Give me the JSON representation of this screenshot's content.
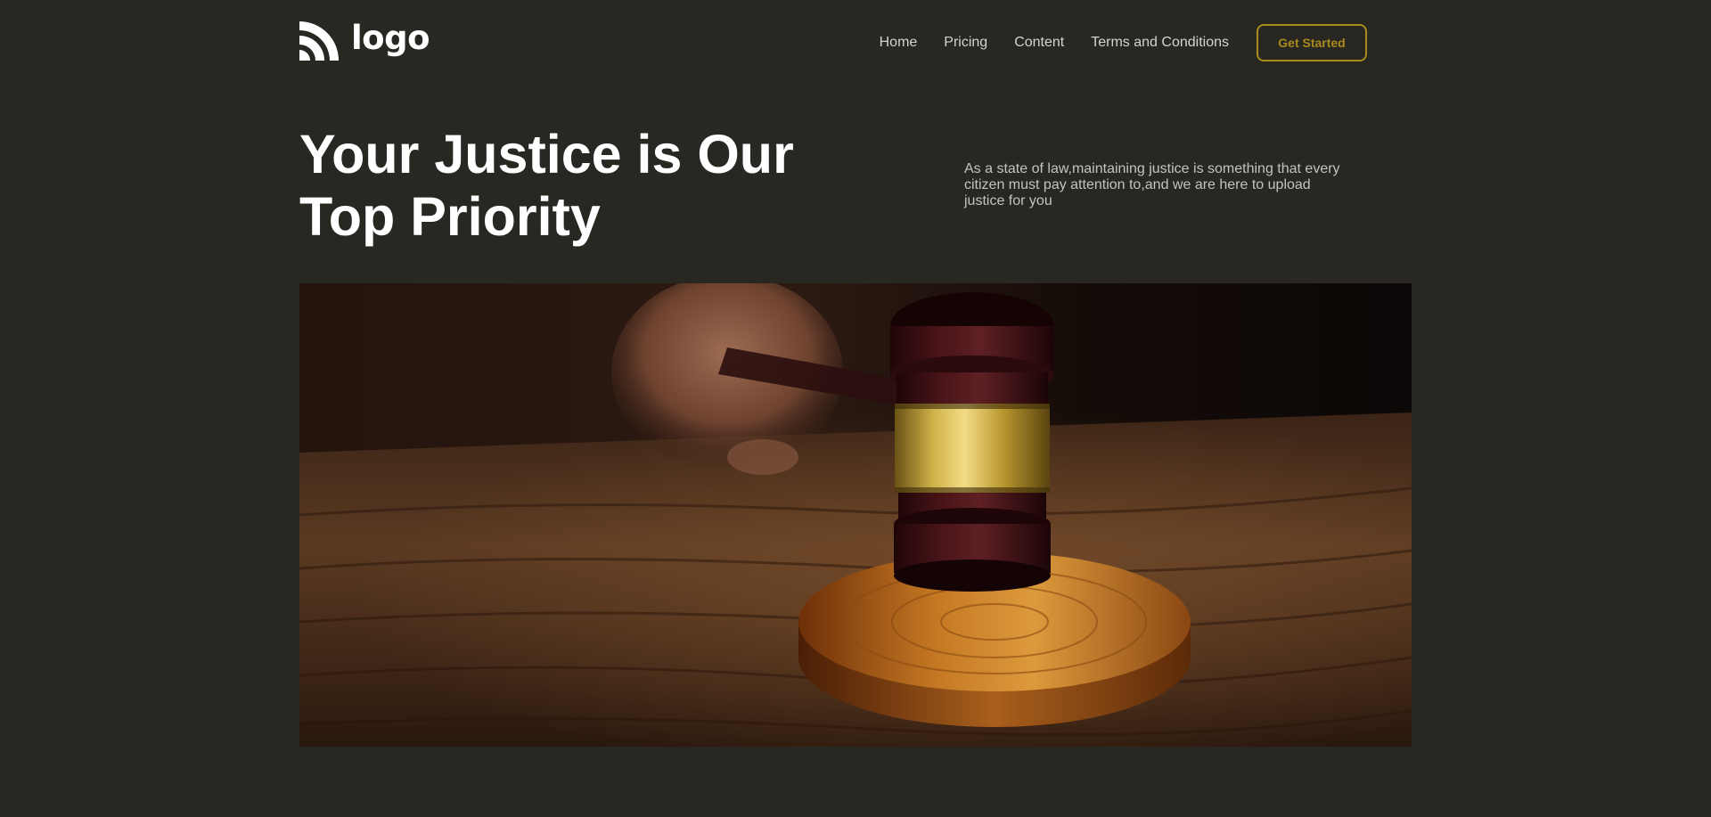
{
  "header": {
    "logo": {
      "text": "logo",
      "icon": "signal-arcs-icon"
    },
    "nav": [
      {
        "label": "Home"
      },
      {
        "label": "Pricing"
      },
      {
        "label": "Content"
      },
      {
        "label": "Terms and Conditions"
      }
    ],
    "cta_label": "Get Started"
  },
  "hero": {
    "title_line1": "Your Justice is Our",
    "title_line2": "Top Priority",
    "description": "As a state of law,maintaining justice is something that every citizen must pay attention to,and we are here to upload justice for you",
    "image": "gavel-photo"
  },
  "colors": {
    "background": "#282722",
    "accent": "#a88a1e",
    "text": "#ffffff",
    "muted_text": "#c4c3be"
  }
}
